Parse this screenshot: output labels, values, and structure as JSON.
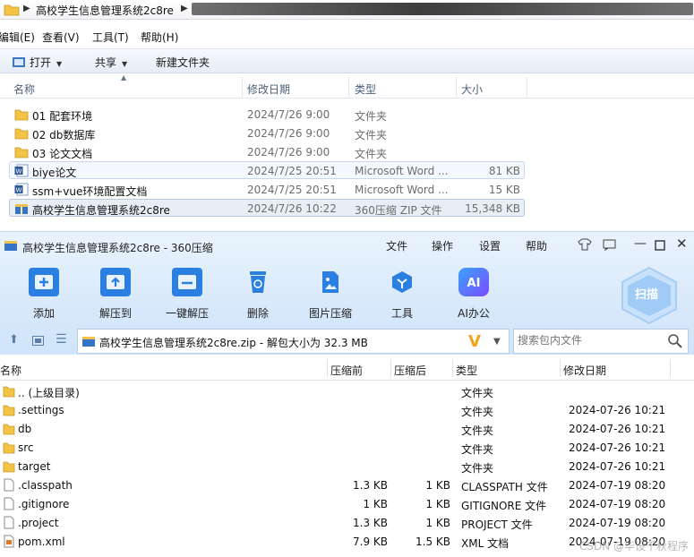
{
  "explorer": {
    "breadcrumb": "高校学生信息管理系统2c8re",
    "menu": [
      "编辑(E)",
      "查看(V)",
      "工具(T)",
      "帮助(H)"
    ],
    "toolbar": {
      "open_label": "打开",
      "share_label": "共享",
      "newfolder_label": "新建文件夹"
    },
    "columns": {
      "name": "名称",
      "date": "修改日期",
      "type": "类型",
      "size": "大小"
    },
    "files": [
      {
        "icon": "folder-icon",
        "name": "01 配套环境",
        "date": "2024/7/26 9:00",
        "type": "文件夹",
        "size": ""
      },
      {
        "icon": "folder-icon",
        "name": "02 db数据库",
        "date": "2024/7/26 9:00",
        "type": "文件夹",
        "size": ""
      },
      {
        "icon": "folder-icon",
        "name": "03 论文文档",
        "date": "2024/7/26 9:00",
        "type": "文件夹",
        "size": ""
      },
      {
        "icon": "word-doc-icon",
        "name": "biye论文",
        "date": "2024/7/25 20:51",
        "type": "Microsoft Word ...",
        "size": "81 KB"
      },
      {
        "icon": "word-doc-icon",
        "name": "ssm+vue环境配置文档",
        "date": "2024/7/25 20:51",
        "type": "Microsoft Word ...",
        "size": "15 KB"
      },
      {
        "icon": "zip-archive-icon",
        "name": "高校学生信息管理系统2c8re",
        "date": "2024/7/26 10:22",
        "type": "360压缩 ZIP 文件",
        "size": "15,348 KB"
      }
    ]
  },
  "zip": {
    "window_title": "高校学生信息管理系统2c8re - 360压缩",
    "menu": [
      "文件",
      "操作",
      "设置",
      "帮助"
    ],
    "tools": [
      {
        "icon": "add-icon",
        "label": "添加"
      },
      {
        "icon": "extract-to-icon",
        "label": "解压到"
      },
      {
        "icon": "one-click-extract-icon",
        "label": "一键解压"
      },
      {
        "icon": "delete-icon",
        "label": "删除"
      },
      {
        "icon": "image-compress-icon",
        "label": "图片压缩"
      },
      {
        "icon": "tools-icon",
        "label": "工具"
      },
      {
        "icon": "ai-office-icon",
        "label": "AI办公"
      }
    ],
    "scan_label": "扫描",
    "path_text": "高校学生信息管理系统2c8re.zip - 解包大小为 32.3 MB",
    "search_placeholder": "搜索包内文件",
    "columns": {
      "name": "名称",
      "before": "压缩前",
      "after": "压缩后",
      "type": "类型",
      "date": "修改日期"
    },
    "files": [
      {
        "icon": "folder-icon",
        "name": ".. (上级目录)",
        "before": "",
        "after": "",
        "type": "文件夹",
        "date": ""
      },
      {
        "icon": "folder-icon",
        "name": ".settings",
        "before": "",
        "after": "",
        "type": "文件夹",
        "date": "2024-07-26 10:21"
      },
      {
        "icon": "folder-icon",
        "name": "db",
        "before": "",
        "after": "",
        "type": "文件夹",
        "date": "2024-07-26 10:21"
      },
      {
        "icon": "folder-icon",
        "name": "src",
        "before": "",
        "after": "",
        "type": "文件夹",
        "date": "2024-07-26 10:21"
      },
      {
        "icon": "folder-icon",
        "name": "target",
        "before": "",
        "after": "",
        "type": "文件夹",
        "date": "2024-07-26 10:21"
      },
      {
        "icon": "file-icon",
        "name": ".classpath",
        "before": "1.3 KB",
        "after": "1 KB",
        "type": "CLASSPATH 文件",
        "date": "2024-07-19 08:20"
      },
      {
        "icon": "file-icon",
        "name": ".gitignore",
        "before": "1 KB",
        "after": "1 KB",
        "type": "GITIGNORE 文件",
        "date": "2024-07-19 08:20"
      },
      {
        "icon": "file-icon",
        "name": ".project",
        "before": "1.3 KB",
        "after": "1 KB",
        "type": "PROJECT 文件",
        "date": "2024-07-19 08:20"
      },
      {
        "icon": "xml-file-icon",
        "name": "pom.xml",
        "before": "7.9 KB",
        "after": "1.5 KB",
        "type": "XML 文档",
        "date": "2024-07-19 08:20"
      }
    ],
    "watermark": "CSDN @毕设千秋程序"
  }
}
